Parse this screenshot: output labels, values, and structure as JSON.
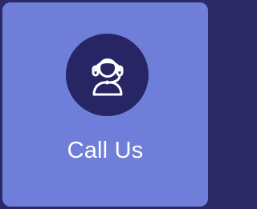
{
  "tile": {
    "label": "Call Us",
    "icon": "headset-support-icon",
    "colors": {
      "page_background": "#2b2a66",
      "tile_background": "#6f7fd9",
      "icon_circle": "#272563",
      "icon_stroke": "#ffffff",
      "label_text": "#ffffff"
    }
  }
}
